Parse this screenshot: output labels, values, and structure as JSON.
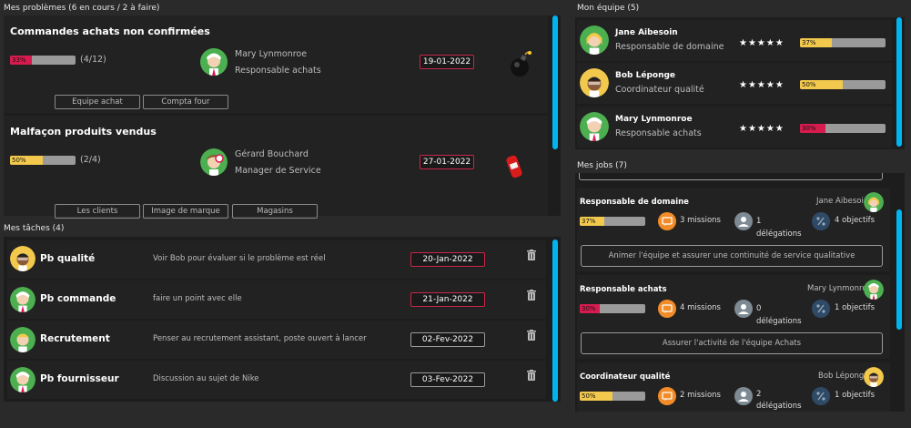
{
  "problems": {
    "title": "Mes problèmes (6 en cours  /  2 à faire)",
    "items": [
      {
        "title": "Commandes achats non confirmées",
        "progress_label": "33%",
        "progress": 0.33,
        "count": "(4/12)",
        "person_name": "Mary Lynmonroe",
        "person_role": "Responsable achats",
        "date": "19-01-2022",
        "tags": [
          "Equipe achat",
          "Compta four"
        ],
        "icon": "bomb-icon",
        "color": "#d81b4f"
      },
      {
        "title": "Malfaçon produits vendus",
        "progress_label": "50%",
        "progress": 0.5,
        "count": "(2/4)",
        "person_name": "Gérard Bouchard",
        "person_role": "Manager de Service",
        "date": "27-01-2022",
        "tags": [
          "Les clients",
          "Image de marque",
          "Magasins"
        ],
        "icon": "fire-extinguisher-icon",
        "color": "#f2c94c"
      }
    ]
  },
  "tasks": {
    "title": "Mes tâches (4)",
    "items": [
      {
        "name": "Pb qualité",
        "desc": "Voir Bob pour évaluer si le problème est réel",
        "date": "20-Jan-2022",
        "avatar": "yellow",
        "date_color": "#c8264a"
      },
      {
        "name": "Pb commande",
        "desc": "faire un point avec elle",
        "date": "21-Jan-2022",
        "avatar": "green",
        "date_color": "#c8264a"
      },
      {
        "name": "Recrutement",
        "desc": "Penser au recrutement assistant, poste ouvert à lancer",
        "date": "02-Fev-2022",
        "avatar": "green",
        "date_color": "#9a9a9a"
      },
      {
        "name": "Pb fournisseur",
        "desc": "Discussion au sujet de Nike",
        "date": "03-Fev-2022",
        "avatar": "green",
        "date_color": "#9a9a9a"
      }
    ]
  },
  "team": {
    "title": "Mon équipe (5)",
    "members": [
      {
        "name": "Jane Aibesoin",
        "role": "Responsable de domaine",
        "stars": "★★★★★",
        "progress_label": "37%",
        "progress": 0.37,
        "color": "#f2c94c",
        "avatar": "yellow"
      },
      {
        "name": "Bob Léponge",
        "role": "Coordinateur qualité",
        "stars": "★★★★★",
        "progress_label": "50%",
        "progress": 0.5,
        "color": "#f2c94c",
        "avatar": "yellow"
      },
      {
        "name": "Mary Lynmonroe",
        "role": "Responsable achats",
        "stars": "★★★★★",
        "progress_label": "30%",
        "progress": 0.3,
        "color": "#d81b4f",
        "avatar": "green"
      }
    ]
  },
  "jobs": {
    "title": "Mes jobs (7)",
    "items": [
      {
        "title": "Responsable de domaine",
        "person": "Jane Aibesoin",
        "progress_label": "37%",
        "progress": 0.37,
        "color": "#f2c94c",
        "missions": "3 missions",
        "delegations_count": "1",
        "delegations_label": "délégations",
        "objectives": "4 objectifs",
        "action": "Animer l'équipe et assurer une continuité de service qualitative",
        "avatar": "yellow"
      },
      {
        "title": "Responsable achats",
        "person": "Mary Lynmonroe",
        "progress_label": "30%",
        "progress": 0.3,
        "color": "#d81b4f",
        "missions": "4 missions",
        "delegations_count": "0",
        "delegations_label": "délégations",
        "objectives": "1 objectifs",
        "action": "Assurer l'activité de l'équipe Achats",
        "avatar": "green"
      },
      {
        "title": "Coordinateur qualité",
        "person": "Bob Léponge",
        "progress_label": "50%",
        "progress": 0.5,
        "color": "#f2c94c",
        "missions": "2 missions",
        "delegations_count": "2",
        "delegations_label": "délégations",
        "objectives": "1 objectifs",
        "action": "",
        "avatar": "yellow"
      }
    ]
  }
}
